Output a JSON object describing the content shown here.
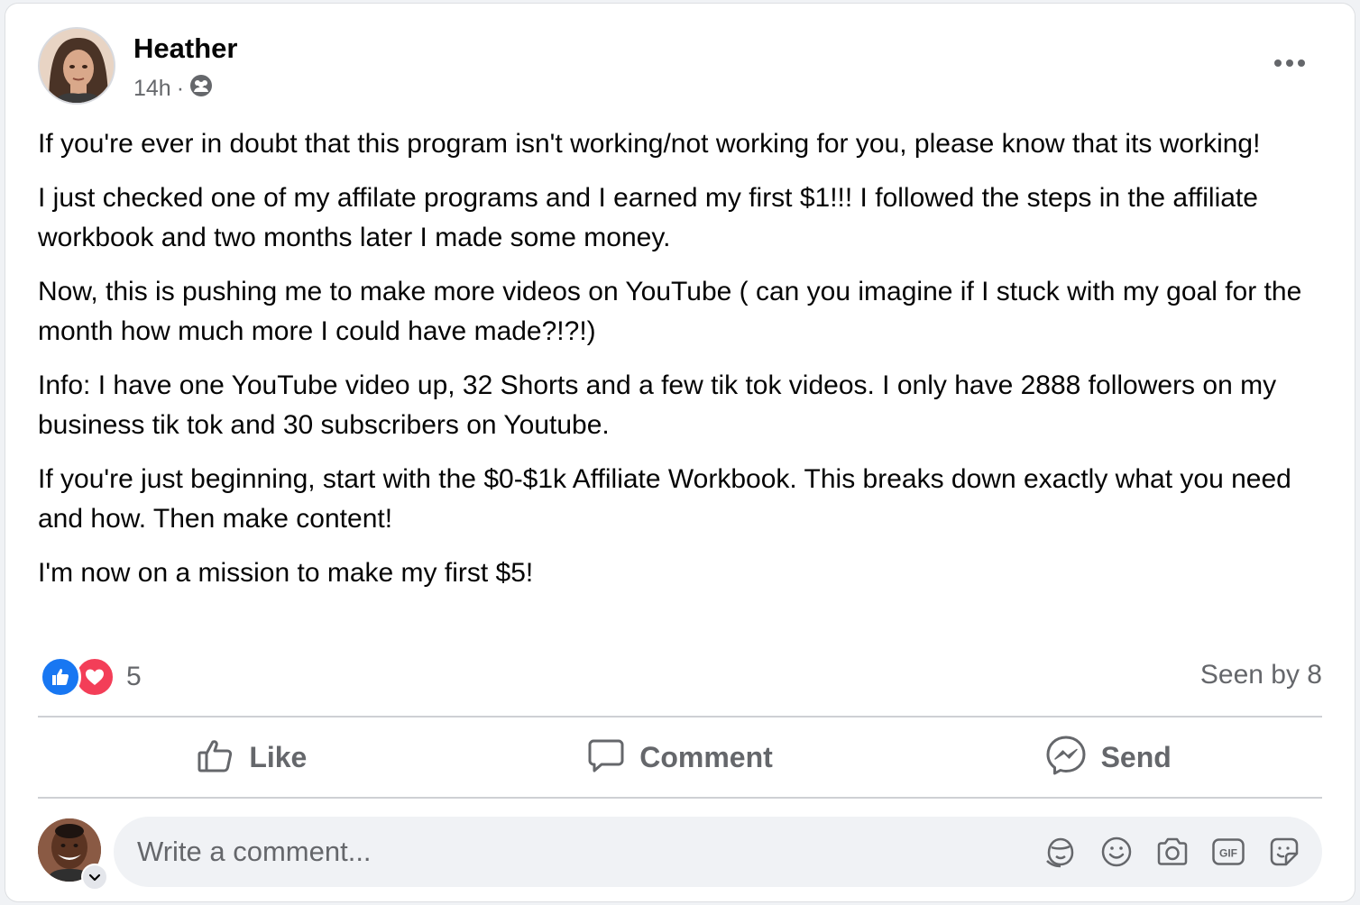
{
  "post": {
    "author": "Heather",
    "time": "14h",
    "separator": "·",
    "audience_icon": "group-audience-icon",
    "paragraphs": [
      "If you're ever in doubt that this program isn't working/not working for you, please know that its working!",
      "I just checked one of my affilate programs and I earned my first $1!!! I followed the steps in the affiliate workbook and two months later I made some money.",
      "Now, this is pushing me to make more videos on YouTube ( can you imagine if I stuck with my goal for the month how much more I could have made?!?!)",
      "Info: I have one YouTube video up, 32 Shorts and a few tik tok videos. I only have 2888 followers on my business tik tok and 30 subscribers on Youtube.",
      "If you're just beginning, start with the $0-$1k Affiliate Workbook. This breaks down exactly what you need and how. Then make content!",
      "I'm now on a mission to make my first $5!"
    ]
  },
  "stats": {
    "reaction_count": "5",
    "reaction_icons": [
      "like-reaction-icon",
      "love-reaction-icon"
    ],
    "seen_by": "Seen by 8"
  },
  "actions": {
    "like": "Like",
    "comment": "Comment",
    "send": "Send"
  },
  "comment_box": {
    "placeholder": "Write a comment..."
  },
  "colors": {
    "like_blue": "#1877f2",
    "love_red": "#f33e58",
    "secondary_text": "#65676b",
    "background": "#f0f2f5"
  }
}
